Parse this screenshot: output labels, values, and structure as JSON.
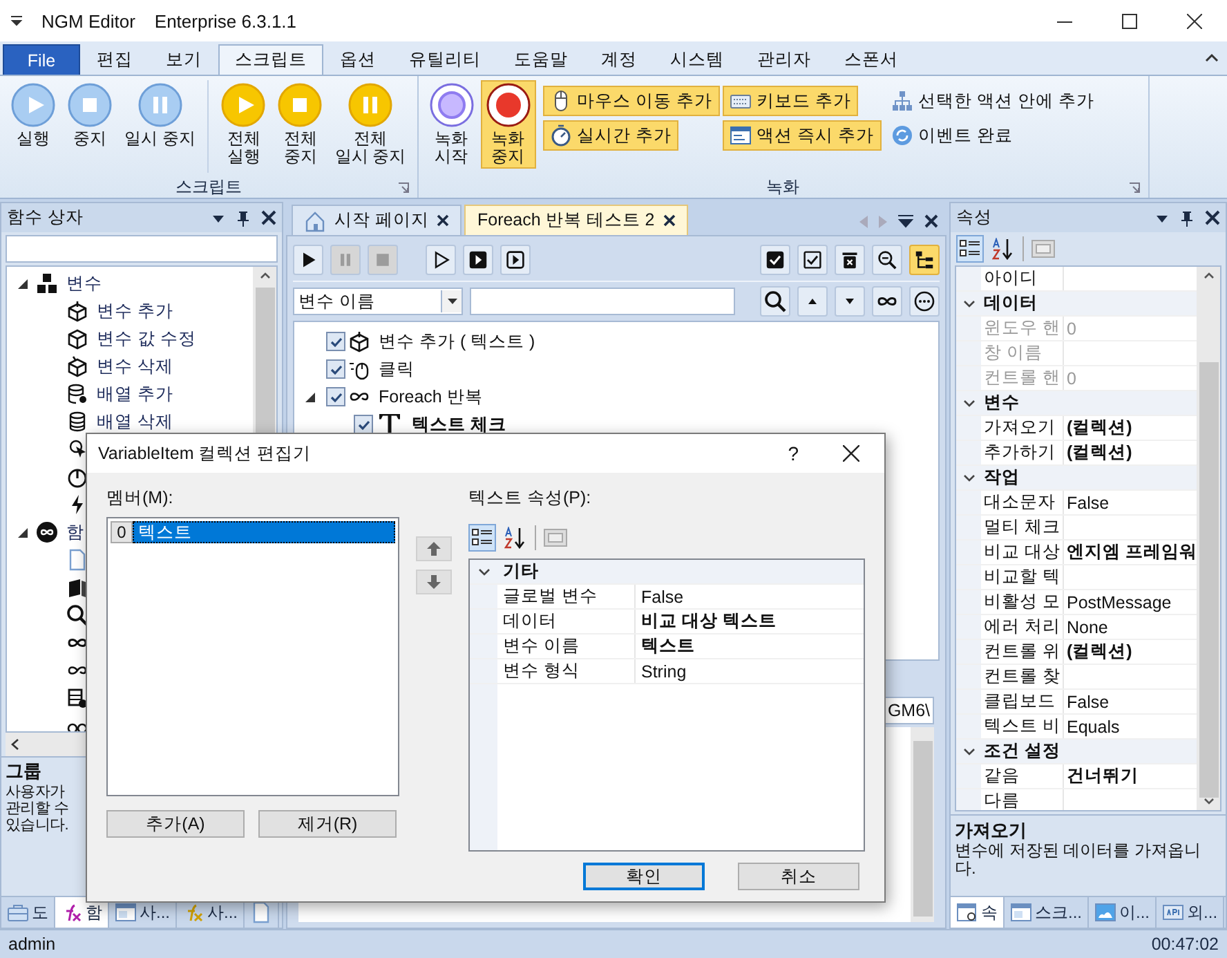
{
  "window": {
    "title": "NGM Editor",
    "edition": "Enterprise 6.3.1.1"
  },
  "ribbon": {
    "tabs": [
      {
        "label": "File",
        "kind": "file",
        "selected": false
      },
      {
        "label": "편집",
        "kind": "tab",
        "selected": false
      },
      {
        "label": "보기",
        "kind": "tab",
        "selected": false
      },
      {
        "label": "스크립트",
        "kind": "tab",
        "selected": true
      },
      {
        "label": "옵션",
        "kind": "tab",
        "selected": false
      },
      {
        "label": "유틸리티",
        "kind": "tab",
        "selected": false
      },
      {
        "label": "도움말",
        "kind": "tab",
        "selected": false
      },
      {
        "label": "계정",
        "kind": "tab",
        "selected": false
      },
      {
        "label": "시스템",
        "kind": "tab",
        "selected": false
      },
      {
        "label": "관리자",
        "kind": "tab",
        "selected": false
      },
      {
        "label": "스폰서",
        "kind": "tab",
        "selected": false
      }
    ],
    "groups": [
      {
        "label": "스크립트",
        "large_buttons": [
          {
            "lines": [
              "실행"
            ],
            "highlighted": false
          },
          {
            "lines": [
              "중지"
            ],
            "highlighted": false
          },
          {
            "lines": [
              "일시 중지"
            ],
            "highlighted": false
          },
          {
            "lines": [
              "전체",
              "실행"
            ],
            "highlighted": false
          },
          {
            "lines": [
              "전체",
              "중지"
            ],
            "highlighted": false
          },
          {
            "lines": [
              "전체",
              "일시 중지"
            ],
            "highlighted": false
          }
        ]
      },
      {
        "label": "녹화",
        "large_buttons": [
          {
            "lines": [
              "녹화",
              "시작"
            ],
            "highlighted": false
          },
          {
            "lines": [
              "녹화",
              "중지"
            ],
            "highlighted": true
          }
        ],
        "small_buttons": [
          {
            "label": "마우스 이동 추가",
            "highlighted": true
          },
          {
            "label": "키보드 추가",
            "highlighted": true
          },
          {
            "label": "선택한 액션 안에 추가",
            "highlighted": false
          },
          {
            "label": "실시간 추가",
            "highlighted": true
          },
          {
            "label": "액션 즉시 추가",
            "highlighted": true
          },
          {
            "label": "이벤트 완료",
            "highlighted": false
          }
        ]
      }
    ]
  },
  "function_box": {
    "title": "함수 상자",
    "tree": [
      {
        "label": "변수",
        "expanded": true,
        "children": [
          {
            "kind": "item",
            "label": "변수 추가"
          },
          {
            "kind": "item",
            "label": "변수 값 수정"
          },
          {
            "kind": "item",
            "label": "변수 삭제"
          },
          {
            "kind": "item",
            "label": "배열 추가"
          },
          {
            "kind": "item",
            "label": "배열 삭제"
          },
          {
            "kind": "icon"
          },
          {
            "kind": "icon"
          },
          {
            "kind": "icon"
          }
        ]
      },
      {
        "label": "함",
        "expanded": true,
        "children": [
          {
            "kind": "icon"
          },
          {
            "kind": "icon"
          },
          {
            "kind": "icon"
          },
          {
            "kind": "icon"
          },
          {
            "kind": "icon"
          },
          {
            "kind": "icon"
          },
          {
            "kind": "icon"
          }
        ]
      }
    ],
    "description": {
      "title": "그룹",
      "lines": [
        "사용자가",
        "관리할 수",
        "있습니다."
      ]
    },
    "tabs": [
      {
        "label": "도",
        "selected": false
      },
      {
        "label": "함",
        "selected": true
      },
      {
        "label": "사...",
        "selected": false
      },
      {
        "label": "사...",
        "selected": false
      },
      {
        "selected": false
      }
    ]
  },
  "editor": {
    "tabs": [
      {
        "label": "시작 페이지",
        "selected": false
      },
      {
        "label": "Foreach 반복 테스트 2",
        "selected": true
      }
    ],
    "toolbar": [
      {
        "disabled": false,
        "pressed": false
      },
      {
        "disabled": true,
        "pressed": false
      },
      {
        "disabled": true,
        "pressed": false
      },
      {
        "disabled": false,
        "pressed": false
      },
      {
        "disabled": false,
        "pressed": false
      },
      {
        "disabled": false,
        "pressed": false
      },
      {
        "disabled": false,
        "pressed": false
      },
      {
        "disabled": false,
        "pressed": false
      },
      {
        "disabled": false,
        "pressed": false
      },
      {
        "disabled": false,
        "pressed": false
      },
      {
        "disabled": false,
        "pressed": true
      }
    ],
    "search_by": "변수 이름",
    "tree": [
      {
        "label": "변수 추가 ( 텍스트 )",
        "checked": true,
        "bold": false
      },
      {
        "label": "클릭",
        "checked": true,
        "bold": false
      },
      {
        "label": "Foreach 반복",
        "checked": true,
        "bold": false,
        "expanded": true,
        "children": [
          {
            "label": "텍스트 체크",
            "checked": true,
            "bold": true
          }
        ]
      }
    ],
    "output": {
      "path": "GM6\\"
    }
  },
  "properties": {
    "title": "속성",
    "rows": [
      {
        "kind": "property",
        "name": "아이디",
        "disabled": false
      },
      {
        "kind": "category",
        "name": "데이터"
      },
      {
        "kind": "property",
        "name": "윈도우 핸",
        "value": "0",
        "disabled": true,
        "bold": false
      },
      {
        "kind": "property",
        "name": "창 이름",
        "disabled": true
      },
      {
        "kind": "property",
        "name": "컨트롤 핸",
        "value": "0",
        "disabled": true,
        "bold": false
      },
      {
        "kind": "category",
        "name": "변수"
      },
      {
        "kind": "property",
        "name": "가져오기",
        "value": "(컬렉션)",
        "disabled": false,
        "bold": true
      },
      {
        "kind": "property",
        "name": "추가하기",
        "value": "(컬렉션)",
        "disabled": false,
        "bold": true
      },
      {
        "kind": "category",
        "name": "작업"
      },
      {
        "kind": "property",
        "name": "대소문자",
        "value": "False",
        "disabled": false,
        "bold": false
      },
      {
        "kind": "property",
        "name": "멀티 체크",
        "disabled": false
      },
      {
        "kind": "property",
        "name": "비교 대상",
        "value": "엔지엠 프레임워",
        "disabled": false,
        "bold": true
      },
      {
        "kind": "property",
        "name": "비교할 텍",
        "disabled": false
      },
      {
        "kind": "property",
        "name": "비활성 모",
        "value": "PostMessage",
        "disabled": false,
        "bold": false
      },
      {
        "kind": "property",
        "name": "에러 처리",
        "value": "None",
        "disabled": false,
        "bold": false
      },
      {
        "kind": "property",
        "name": "컨트롤 위",
        "value": "(컬렉션)",
        "disabled": false,
        "bold": true
      },
      {
        "kind": "property",
        "name": "컨트롤 찾",
        "disabled": false
      },
      {
        "kind": "property",
        "name": "클립보드",
        "value": "False",
        "disabled": false,
        "bold": false
      },
      {
        "kind": "property",
        "name": "텍스트 비",
        "value": "Equals",
        "disabled": false,
        "bold": false
      },
      {
        "kind": "category",
        "name": "조건 설정"
      },
      {
        "kind": "property",
        "name": "같음",
        "value": "건너뛰기",
        "disabled": false,
        "bold": true
      },
      {
        "kind": "property",
        "name": "다름",
        "disabled": false
      }
    ],
    "description": {
      "title": "가져오기",
      "text": "변수에 저장된 데이터를 가져옵니다."
    },
    "tabs": [
      {
        "label": "속",
        "selected": true
      },
      {
        "label": "스크...",
        "selected": false
      },
      {
        "label": "이...",
        "selected": false
      },
      {
        "label": "외...",
        "selected": false
      }
    ]
  },
  "dialog": {
    "title": "VariableItem 컬렉션 편집기",
    "help": "?",
    "members_label": "멤버(M):",
    "members": [
      {
        "index": "0",
        "label": "텍스트",
        "selected": true
      }
    ],
    "add": "추가(A)",
    "remove": "제거(R)",
    "props_label": "텍스트 속성(P):",
    "rows": [
      {
        "kind": "category",
        "name": "기타"
      },
      {
        "kind": "property",
        "name": "글로벌 변수",
        "value": "False",
        "bold": false
      },
      {
        "kind": "property",
        "name": "데이터",
        "value": "비교 대상 텍스트",
        "bold": true
      },
      {
        "kind": "property",
        "name": "변수 이름",
        "value": "텍스트",
        "bold": true
      },
      {
        "kind": "property",
        "name": "변수 형식",
        "value": "String",
        "bold": false
      }
    ],
    "ok": "확인",
    "cancel": "취소"
  },
  "status_bar": {
    "user": "admin",
    "time": "00:47:02"
  }
}
